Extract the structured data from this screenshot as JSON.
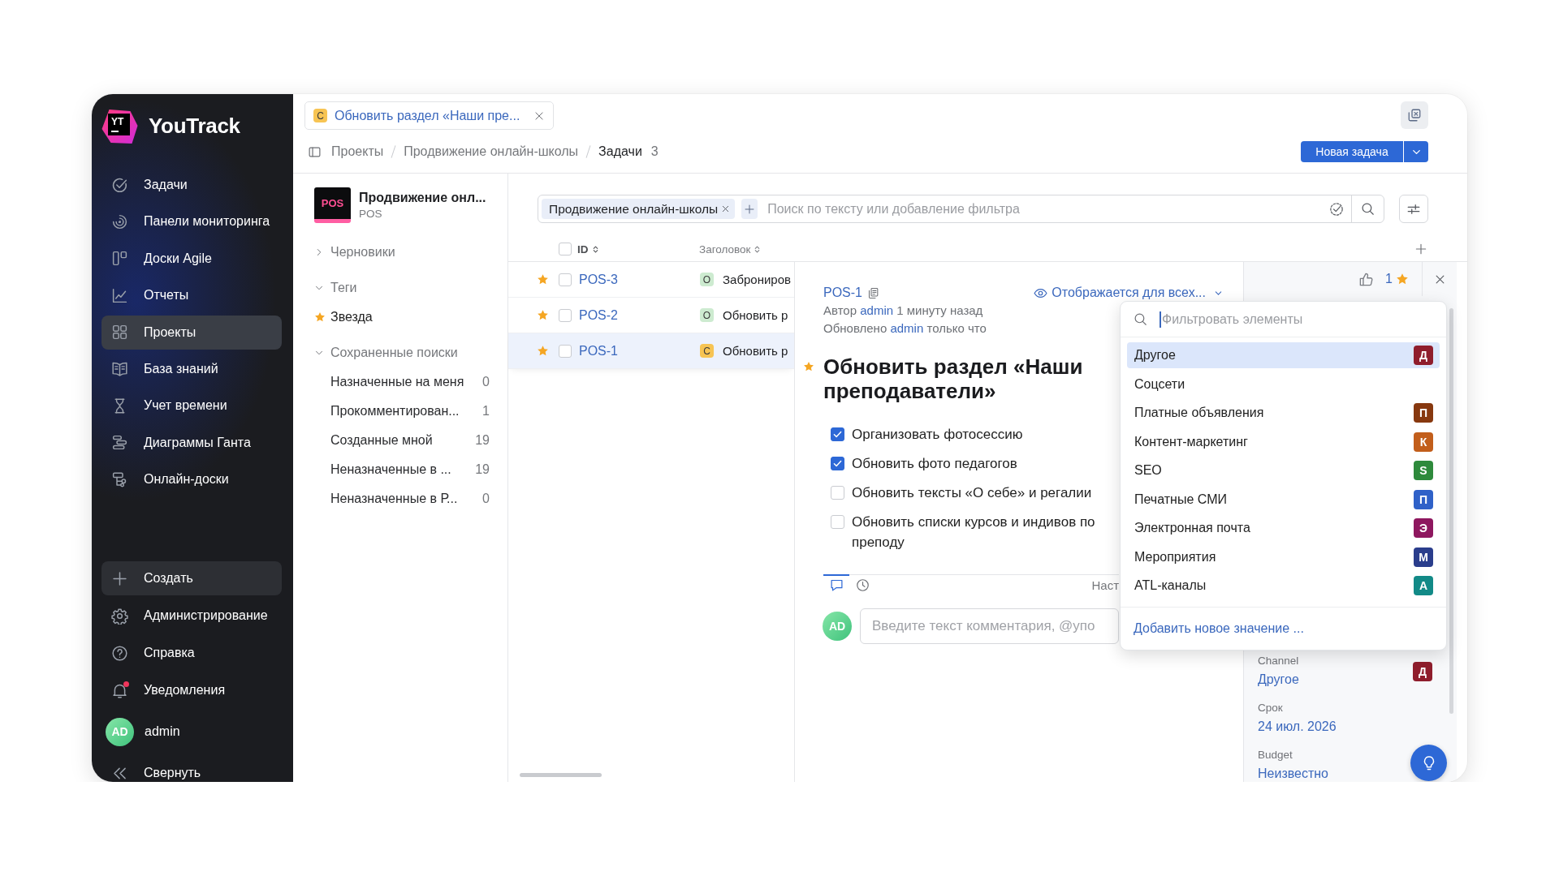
{
  "sidebar": {
    "logo": {
      "mark": "YT",
      "name": "YouTrack"
    },
    "nav": [
      {
        "label": "Задачи",
        "selected": false
      },
      {
        "label": "Панели мониторинга",
        "selected": false
      },
      {
        "label": "Доски Agile",
        "selected": false
      },
      {
        "label": "Отчеты",
        "selected": false
      },
      {
        "label": "Проекты",
        "selected": true
      },
      {
        "label": "База знаний",
        "selected": false
      },
      {
        "label": "Учет времени",
        "selected": false
      },
      {
        "label": "Диаграммы Ганта",
        "selected": false
      },
      {
        "label": "Онлайн-доски",
        "selected": false
      }
    ],
    "actions": [
      {
        "kind": "create",
        "label": "Создать",
        "unread": false
      },
      {
        "kind": "item",
        "label": "Администрирование",
        "unread": false
      },
      {
        "kind": "item",
        "label": "Справка",
        "unread": false
      },
      {
        "kind": "item",
        "label": "Уведомления",
        "unread": true
      }
    ],
    "user": {
      "initials": "AD",
      "name": "admin"
    },
    "collapse": "Свернуть"
  },
  "open_tab": {
    "state": "С",
    "color": "#f7c453",
    "title": "Обновить раздел «Наши пре..."
  },
  "breadcrumbs": [
    {
      "label": "Проекты",
      "current": false
    },
    {
      "label": "Продвижение онлайн-школы",
      "current": false
    },
    {
      "label": "Задачи",
      "current": true
    }
  ],
  "issue_count": "3",
  "new_issue_button": "Новая задача",
  "project": {
    "logo": "POS",
    "name": "Продвижение онл...",
    "key": "POS"
  },
  "project_nav": [
    {
      "label": "Черновики",
      "expanded": false
    },
    {
      "label": "Теги",
      "expanded": true,
      "children": [
        {
          "kind": "tag",
          "label": "Звезда"
        }
      ]
    },
    {
      "label": "Сохраненные поиски",
      "expanded": true,
      "children": [
        {
          "kind": "saved_search",
          "label": "Назначенные на меня",
          "count": "0"
        },
        {
          "kind": "saved_search",
          "label": "Прокомментирован...",
          "count": "1"
        },
        {
          "kind": "saved_search",
          "label": "Созданные мной",
          "count": "19"
        },
        {
          "kind": "saved_search",
          "label": "Неназначенные в ...",
          "count": "19"
        },
        {
          "kind": "saved_search",
          "label": "Неназначенные в Р...",
          "count": "0"
        }
      ]
    }
  ],
  "search": {
    "chips": [
      {
        "label": "Продвижение онлайн-школы"
      }
    ],
    "placeholder": "Поиск по тексту или добавление фильтра"
  },
  "table": {
    "all_checked": false,
    "columns": [
      {
        "label": "ID"
      },
      {
        "label": "Заголовок"
      }
    ],
    "rows": [
      {
        "starred": true,
        "checked": false,
        "selected": false,
        "id": "POS-3",
        "state": "О",
        "color": "#cdebd0",
        "title": "Заброниров"
      },
      {
        "starred": true,
        "checked": false,
        "selected": false,
        "id": "POS-2",
        "state": "О",
        "color": "#cdebd0",
        "title": "Обновить р"
      },
      {
        "starred": true,
        "checked": false,
        "selected": true,
        "id": "POS-1",
        "state": "С",
        "color": "#f7c453",
        "title": "Обновить р"
      }
    ]
  },
  "detail": {
    "id": "POS-1",
    "visibility": "Отображается для всех...",
    "meta": [
      {
        "label": "Автор",
        "user": "admin",
        "time": "1 минуту назад"
      },
      {
        "label": "Обновлено",
        "user": "admin",
        "time": "только что"
      }
    ],
    "starred": true,
    "title": "Обновить раздел «Наши преподаватели»",
    "checklist": [
      {
        "text": "Организовать фотосессию",
        "checked": true
      },
      {
        "text": "Обновить фото педагогов",
        "checked": true
      },
      {
        "text": "Обновить тексты «О себе» и регалии",
        "checked": false
      },
      {
        "text": "Обновить списки курсов и индивов по преподу",
        "checked": false
      }
    ],
    "activity": {
      "tabs": [
        {
          "kind": "comments",
          "selected": true
        },
        {
          "kind": "history",
          "selected": false
        }
      ],
      "link": "Наст"
    },
    "comment": {
      "initials": "AD",
      "placeholder": "Введите текст комментария, @упо"
    }
  },
  "side_panel": {
    "star_count": "1",
    "fields": [
      {
        "label": "Channel",
        "value": "Другое",
        "letter": "Д",
        "color": "#8f1d2c"
      },
      {
        "label": "Срок",
        "value": "24 июл. 2026"
      },
      {
        "label": "Budget",
        "value": "Неизвестно"
      }
    ]
  },
  "dropdown": {
    "placeholder": "Фильтровать элементы",
    "options": [
      {
        "label": "Другое",
        "letter": "Д",
        "color": "#8f1d2c",
        "selected": true
      },
      {
        "label": "Соцсети",
        "selected": false
      },
      {
        "label": "Платные объявления",
        "letter": "П",
        "color": "#87380f",
        "selected": false
      },
      {
        "label": "Контент-маркетинг",
        "letter": "К",
        "color": "#c25e1b",
        "selected": false
      },
      {
        "label": "SEO",
        "letter": "S",
        "color": "#2e8a3c",
        "selected": false
      },
      {
        "label": "Печатные СМИ",
        "letter": "П",
        "color": "#2f61c8",
        "selected": false
      },
      {
        "label": "Электронная почта",
        "letter": "Э",
        "color": "#8e175f",
        "selected": false
      },
      {
        "label": "Мероприятия",
        "letter": "М",
        "color": "#2a3d8c",
        "selected": false
      },
      {
        "label": "ATL-каналы",
        "letter": "А",
        "color": "#128a87",
        "selected": false
      }
    ],
    "add_link": "Добавить новое значение ..."
  }
}
